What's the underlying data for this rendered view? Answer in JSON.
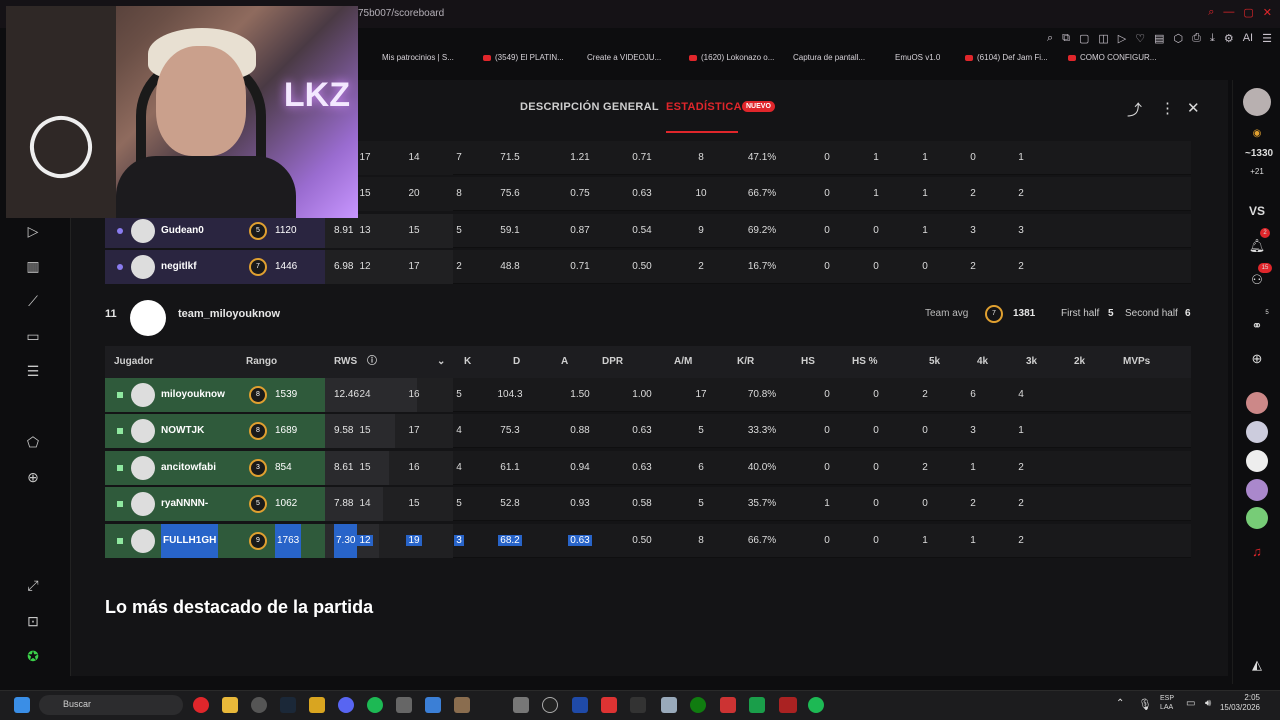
{
  "browser": {
    "url_fragment": "75b007/scoreboard",
    "bookmarks": [
      "Mis patrocinios | S...",
      "(3549) El PLATIN...",
      "Create a VIDEOJU...",
      "(1620) Lokonazo o...",
      "Captura de pantall...",
      "EmuOS v1.0",
      "(6104) Def Jam Fi...",
      "COMO CONFIGUR..."
    ],
    "ai_label": "AI"
  },
  "tabs": {
    "overview": "DESCRIPCIÓN GENERAL",
    "stats": "ESTADÍSTICAS",
    "badge": "NUEVO"
  },
  "team1_rows": [
    {
      "name": "",
      "elo": "",
      "rws": "",
      "k": "17",
      "d": "14",
      "a": "7",
      "dpr": "71.5",
      "am": "1.21",
      "kr": "0.71",
      "hs": "8",
      "hsp": "47.1%",
      "k5": "0",
      "k4": "1",
      "k3": "1",
      "k2": "0",
      "mvp": "1"
    },
    {
      "name": "",
      "elo": "",
      "rws": "",
      "k": "15",
      "d": "20",
      "a": "8",
      "dpr": "75.6",
      "am": "0.75",
      "kr": "0.63",
      "hs": "10",
      "hsp": "66.7%",
      "k5": "0",
      "k4": "1",
      "k3": "1",
      "k2": "2",
      "mvp": "2"
    },
    {
      "name": "Gudean0",
      "level": "5",
      "elo": "1120",
      "rws": "8.91",
      "k": "13",
      "d": "15",
      "a": "5",
      "dpr": "59.1",
      "am": "0.87",
      "kr": "0.54",
      "hs": "9",
      "hsp": "69.2%",
      "k5": "0",
      "k4": "0",
      "k3": "1",
      "k2": "3",
      "mvp": "3"
    },
    {
      "name": "negitlkf",
      "level": "7",
      "elo": "1446",
      "rws": "6.98",
      "k": "12",
      "d": "17",
      "a": "2",
      "dpr": "48.8",
      "am": "0.71",
      "kr": "0.50",
      "hs": "2",
      "hsp": "16.7%",
      "k5": "0",
      "k4": "0",
      "k3": "0",
      "k2": "2",
      "mvp": "2"
    }
  ],
  "team2": {
    "score": "11",
    "name": "team_miloyouknow",
    "avg_label": "Team avg",
    "avg_level": "7",
    "avg_elo": "1381",
    "first_half_label": "First half",
    "first_half": "5",
    "second_half_label": "Second half",
    "second_half": "6"
  },
  "headers": {
    "player": "Jugador",
    "rank": "Rango",
    "rws": "RWS",
    "k": "K",
    "d": "D",
    "a": "A",
    "dpr": "DPR",
    "am": "A/M",
    "kr": "K/R",
    "hs": "HS",
    "hsp": "HS %",
    "k5": "5k",
    "k4": "4k",
    "k3": "3k",
    "k2": "2k",
    "mvp": "MVPs"
  },
  "team2_rows": [
    {
      "name": "miloyouknow",
      "level": "8",
      "elo": "1539",
      "rws": "12.46",
      "rws_fraction": 0.72,
      "k": "24",
      "d": "16",
      "a": "5",
      "dpr": "104.3",
      "am": "1.50",
      "kr": "1.00",
      "hs": "17",
      "hsp": "70.8%",
      "k5": "0",
      "k4": "0",
      "k3": "2",
      "k2": "6",
      "mvp": "4"
    },
    {
      "name": "NOWTJK",
      "level": "8",
      "elo": "1689",
      "rws": "9.58",
      "rws_fraction": 0.55,
      "k": "15",
      "d": "17",
      "a": "4",
      "dpr": "75.3",
      "am": "0.88",
      "kr": "0.63",
      "hs": "5",
      "hsp": "33.3%",
      "k5": "0",
      "k4": "0",
      "k3": "0",
      "k2": "3",
      "mvp": "1"
    },
    {
      "name": "ancitowfabi",
      "level": "3",
      "elo": "854",
      "rws": "8.61",
      "rws_fraction": 0.5,
      "k": "15",
      "d": "16",
      "a": "4",
      "dpr": "61.1",
      "am": "0.94",
      "kr": "0.63",
      "hs": "6",
      "hsp": "40.0%",
      "k5": "0",
      "k4": "0",
      "k3": "2",
      "k2": "1",
      "mvp": "2"
    },
    {
      "name": "ryaNNNN-",
      "level": "5",
      "elo": "1062",
      "rws": "7.88",
      "rws_fraction": 0.45,
      "k": "14",
      "d": "15",
      "a": "5",
      "dpr": "52.8",
      "am": "0.93",
      "kr": "0.58",
      "hs": "5",
      "hsp": "35.7%",
      "k5": "1",
      "k4": "0",
      "k3": "0",
      "k2": "2",
      "mvp": "2"
    },
    {
      "name": "FULLH1GH",
      "level": "9",
      "elo": "1763",
      "rws": "7.30",
      "rws_fraction": 0.42,
      "k": "12",
      "d": "19",
      "a": "3",
      "dpr": "68.2",
      "am": "0.63",
      "kr": "0.50",
      "hs": "8",
      "hsp": "66.7%",
      "k5": "0",
      "k4": "0",
      "k3": "1",
      "k2": "1",
      "mvp": "2"
    }
  ],
  "highlights_title": "Lo más destacado de la partida",
  "right_sidebar": {
    "points": "~1330",
    "delta": "+21",
    "vs": "VS",
    "notif_count": "2",
    "friends_count": "15",
    "party_count": "5"
  },
  "taskbar": {
    "search_placeholder": "Buscar",
    "lang1": "ESP",
    "lang2": "LAA",
    "time": "2:05",
    "date": "15/03/2026"
  },
  "colors": {
    "accent": "#e0262b",
    "team_green": "#2f5a3b",
    "selection": "#2864c9"
  }
}
